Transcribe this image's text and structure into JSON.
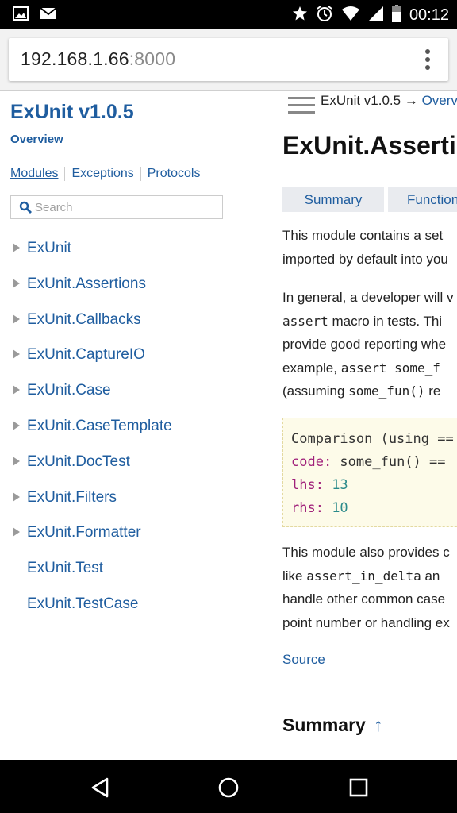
{
  "status_bar": {
    "time": "00:12",
    "icons": [
      "image-icon",
      "gmail-icon",
      "star-icon",
      "alarm-icon",
      "wifi-icon",
      "signal-icon",
      "battery-icon"
    ]
  },
  "browser": {
    "url_host": "192.168.1.66",
    "url_port": ":8000",
    "menu_icon": "more-vert-icon"
  },
  "sidebar": {
    "title": "ExUnit v1.0.5",
    "overview": "Overview",
    "nav": [
      "Modules",
      "Exceptions",
      "Protocols"
    ],
    "search_placeholder": "Search",
    "modules": [
      {
        "name": "ExUnit",
        "expandable": true
      },
      {
        "name": "ExUnit.Assertions",
        "expandable": true
      },
      {
        "name": "ExUnit.Callbacks",
        "expandable": true
      },
      {
        "name": "ExUnit.CaptureIO",
        "expandable": true
      },
      {
        "name": "ExUnit.Case",
        "expandable": true
      },
      {
        "name": "ExUnit.CaseTemplate",
        "expandable": true
      },
      {
        "name": "ExUnit.DocTest",
        "expandable": true
      },
      {
        "name": "ExUnit.Filters",
        "expandable": true
      },
      {
        "name": "ExUnit.Formatter",
        "expandable": true
      },
      {
        "name": "ExUnit.Test",
        "expandable": false
      },
      {
        "name": "ExUnit.TestCase",
        "expandable": false
      }
    ]
  },
  "content": {
    "breadcrumb_project": "ExUnit v1.0.5",
    "breadcrumb_arrow": "→",
    "breadcrumb_link": "Overv",
    "title": "ExUnit.Asserti",
    "tabs": [
      "Summary",
      "Function"
    ],
    "para1_line1": "This module contains a set",
    "para1_line2": "imported by default into you",
    "para2_line1": "In general, a developer will v",
    "para2_line2_code": "assert",
    "para2_line2_text": " macro in tests. Thi",
    "para2_line3": "provide good reporting whe",
    "para2_line4_text": "example, ",
    "para2_line4_code": "assert some_f",
    "para2_line5_text1": "(assuming ",
    "para2_line5_code": "some_fun()",
    "para2_line5_text2": " re",
    "code_line1": "Comparison (using ==",
    "code_line2_key": "code:",
    "code_line2_val": " some_fun() ==",
    "code_line3_key": "lhs:",
    "code_line3_val": "  13",
    "code_line4_key": "rhs:",
    "code_line4_val": "  10",
    "para3_line1": "This module also provides c",
    "para3_line2_text": "like ",
    "para3_line2_code": "assert_in_delta",
    "para3_line2_text2": " an",
    "para3_line3": "handle other common case",
    "para3_line4": "point number or handling ex",
    "source_link": "Source",
    "summary_heading": "Summary",
    "summary_arrow": "↑"
  },
  "nav_bar": {
    "buttons": [
      "back-icon",
      "home-icon",
      "recents-icon"
    ]
  }
}
